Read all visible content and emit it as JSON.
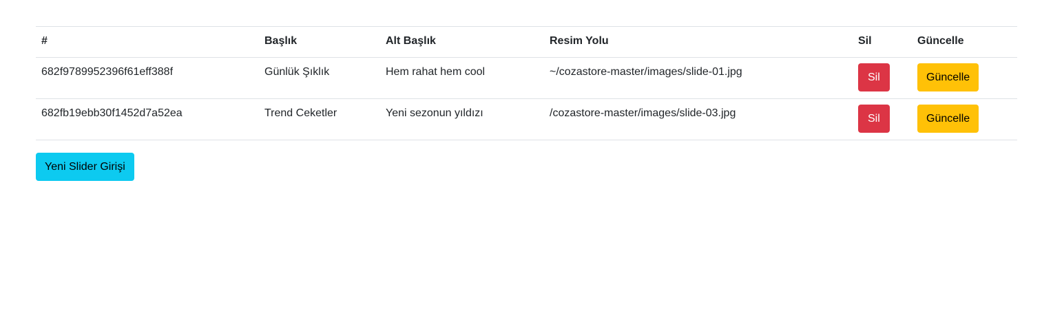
{
  "table": {
    "headers": {
      "id": "#",
      "title": "Başlık",
      "subtitle": "Alt Başlık",
      "image_path": "Resim Yolu",
      "delete": "Sil",
      "update": "Güncelle"
    },
    "rows": [
      {
        "id": "682f9789952396f61eff388f",
        "title": "Günlük Şıklık",
        "subtitle": "Hem rahat hem cool",
        "image_path": "~/cozastore-master/images/slide-01.jpg",
        "delete_label": "Sil",
        "update_label": "Güncelle"
      },
      {
        "id": "682fb19ebb30f1452d7a52ea",
        "title": "Trend Ceketler",
        "subtitle": "Yeni sezonun yıldızı",
        "image_path": "/cozastore-master/images/slide-03.jpg",
        "delete_label": "Sil",
        "update_label": "Güncelle"
      }
    ]
  },
  "actions": {
    "new_slider_label": "Yeni Slider Girişi"
  },
  "colors": {
    "danger": "#dc3545",
    "warning": "#ffc107",
    "info": "#0dcaf0",
    "border": "#dee2e6"
  }
}
